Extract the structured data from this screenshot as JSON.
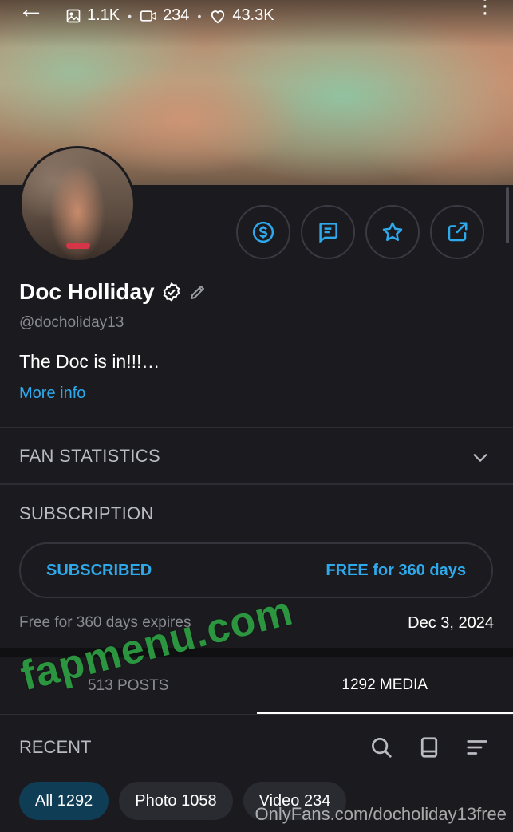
{
  "header": {
    "back_icon": "arrow-left-icon",
    "more_icon": "more-vertical-icon",
    "stats": {
      "photos": "1.1K",
      "videos": "234",
      "likes": "43.3K"
    }
  },
  "profile": {
    "name": "Doc Holliday",
    "handle": "@docholiday13",
    "bio": "The Doc is in!!!…",
    "more_info": "More info",
    "verified_icon": "verified-badge-icon",
    "edit_icon": "pencil-icon"
  },
  "actions": [
    {
      "icon": "dollar-icon"
    },
    {
      "icon": "message-icon"
    },
    {
      "icon": "star-icon"
    },
    {
      "icon": "share-icon"
    }
  ],
  "fan_statistics": {
    "title": "FAN STATISTICS"
  },
  "subscription": {
    "title": "SUBSCRIPTION",
    "status": "SUBSCRIBED",
    "price": "FREE for 360 days",
    "expires_label": "Free for 360 days expires",
    "expires_date": "Dec 3, 2024"
  },
  "tabs": [
    {
      "label": "513 POSTS",
      "active": false
    },
    {
      "label": "1292 MEDIA",
      "active": true
    }
  ],
  "media": {
    "section_title": "RECENT",
    "filters": [
      {
        "label": "All 1292",
        "active": true
      },
      {
        "label": "Photo 1058",
        "active": false
      },
      {
        "label": "Video 234",
        "active": false
      }
    ]
  },
  "watermark": {
    "logo": "fapmenu.com",
    "url": "OnlyFans.com/docholiday13free"
  },
  "colors": {
    "accent": "#2da9ec",
    "background": "#1b1b1f",
    "watermark_green": "#2ea043"
  }
}
